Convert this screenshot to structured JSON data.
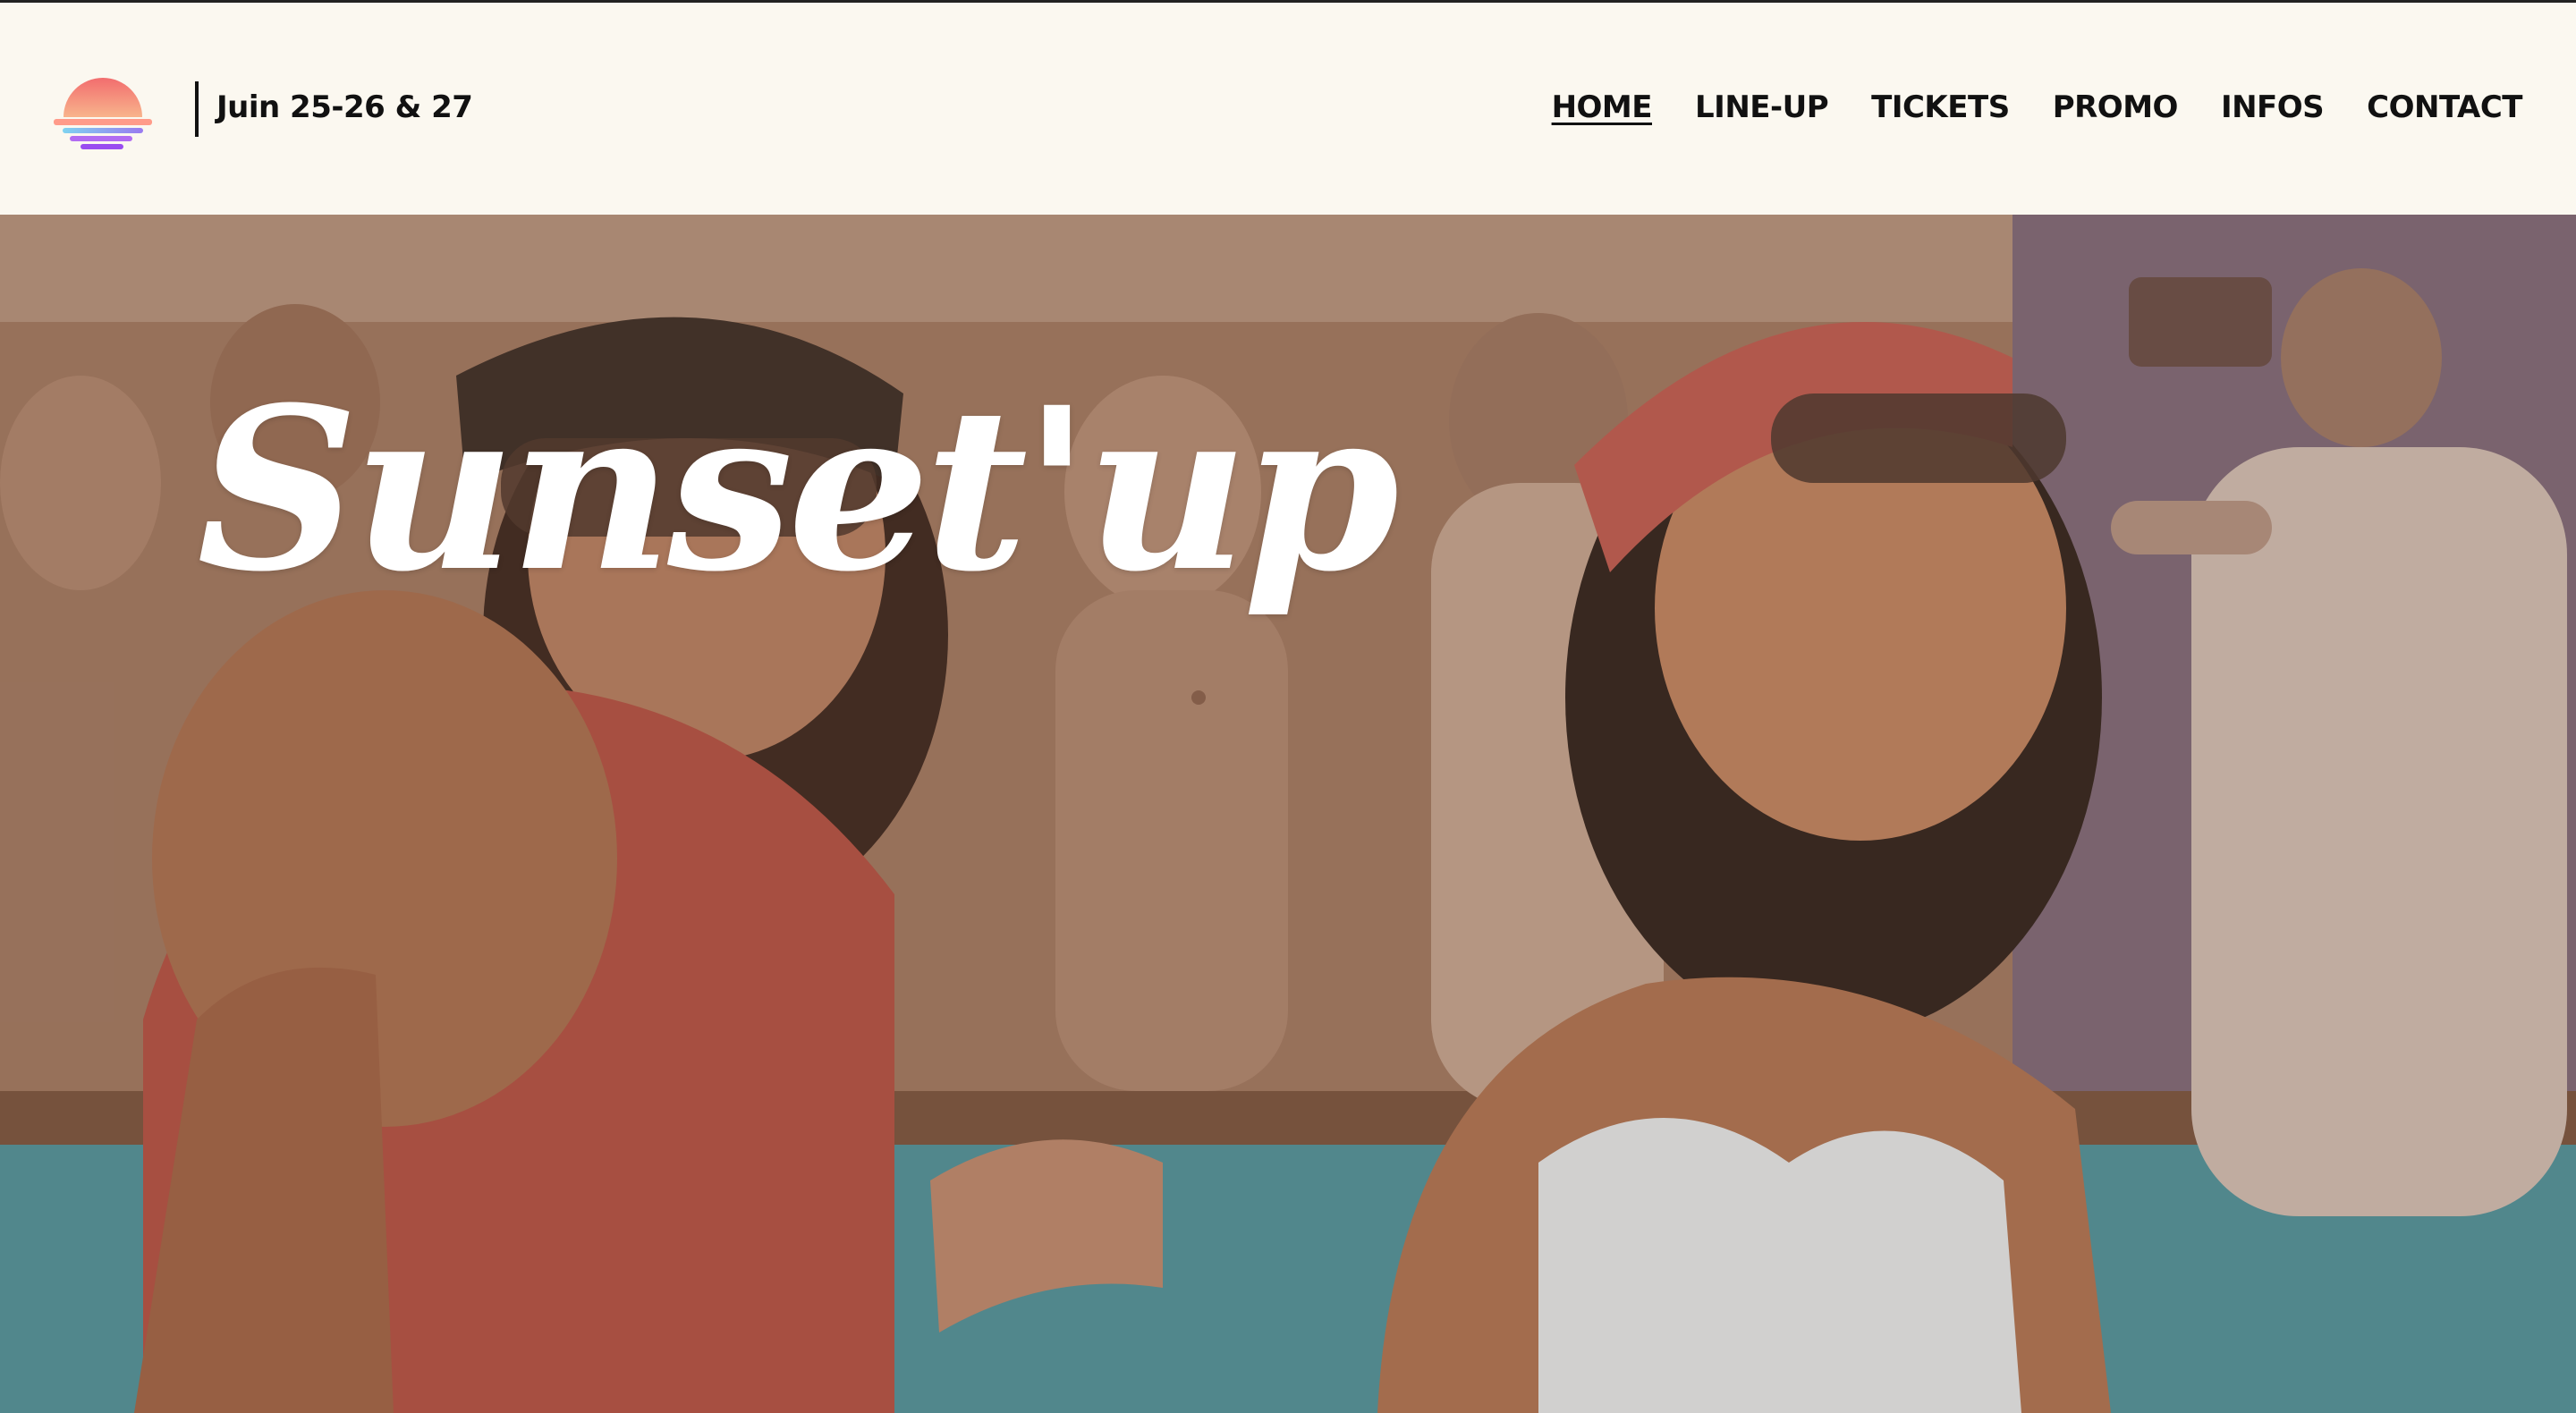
{
  "header": {
    "dates": "Juin 25-26 & 27",
    "logo_icon": "sunset-logo-icon",
    "nav": [
      {
        "label": "HOME",
        "active": true
      },
      {
        "label": "LINE-UP",
        "active": false
      },
      {
        "label": "TICKETS",
        "active": false
      },
      {
        "label": "PROMO",
        "active": false
      },
      {
        "label": "INFOS",
        "active": false
      },
      {
        "label": "CONTACT",
        "active": false
      }
    ]
  },
  "hero": {
    "title": "Sunset'up"
  },
  "colors": {
    "background": "#fbf8f0",
    "text": "#111111",
    "logo_sun_top": "#f47a6c",
    "logo_sun_bottom": "#f8b48c",
    "logo_water_blue": "#7fd3f0",
    "logo_water_purple": "#9a4df0"
  }
}
